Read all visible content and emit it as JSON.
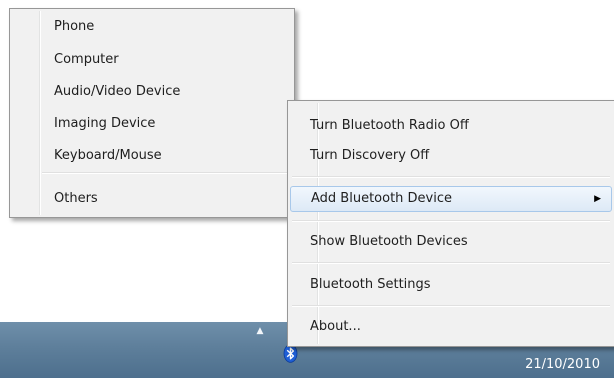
{
  "taskbar": {
    "clock_date": "21/10/2010",
    "tray_arrow_icon": "triangle-up",
    "tray_bluetooth_icon": "bluetooth-icon"
  },
  "bluetooth_menu": {
    "items": [
      {
        "label": "Turn Bluetooth Radio Off"
      },
      {
        "label": "Turn Discovery Off"
      },
      {
        "label": "Add Bluetooth Device",
        "highlighted": true,
        "has_submenu": true
      },
      {
        "label": "Show Bluetooth Devices"
      },
      {
        "label": "Bluetooth Settings"
      },
      {
        "label": "About..."
      }
    ]
  },
  "add_device_submenu": {
    "items": [
      {
        "label": "Phone"
      },
      {
        "label": "Computer"
      },
      {
        "label": "Audio/Video Device"
      },
      {
        "label": "Imaging Device"
      },
      {
        "label": "Keyboard/Mouse"
      },
      {
        "label": "Others"
      }
    ]
  },
  "colors": {
    "menu_bg": "#f1f1f1",
    "highlight_border": "#a8c8ea",
    "taskbar": "#5e7f9b",
    "bluetooth_blue": "#1f5fd6"
  }
}
